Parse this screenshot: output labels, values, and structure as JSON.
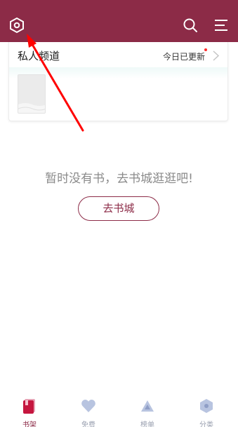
{
  "header": {
    "settings_icon": "settings-hexagon-icon",
    "search_icon": "search-icon",
    "menu_icon": "menu-icon",
    "background_color": "#8c2b47"
  },
  "channel": {
    "title": "私人频道",
    "update_text": "今日已更新",
    "chevron_icon": "chevron-right-icon"
  },
  "empty_state": {
    "message": "暂时没有书，去书城逛逛吧!",
    "button_label": "去书城"
  },
  "tabs": [
    {
      "label": "书架",
      "icon": "bookshelf-icon",
      "active": true
    },
    {
      "label": "免费",
      "icon": "heart-icon",
      "active": false
    },
    {
      "label": "榜单",
      "icon": "triangle-icon",
      "active": false
    },
    {
      "label": "分类",
      "icon": "hexagon-icon",
      "active": false
    }
  ],
  "colors": {
    "accent": "#8c2b47",
    "annotation_arrow": "#ff0000"
  }
}
